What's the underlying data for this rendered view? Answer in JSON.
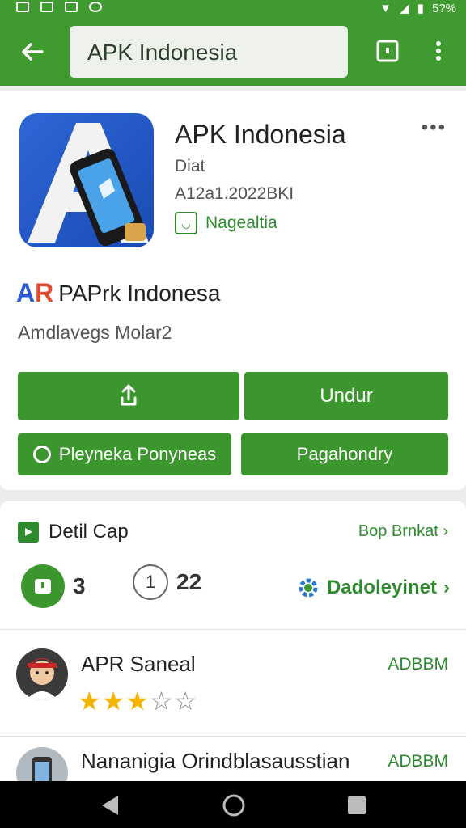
{
  "status_bar": {
    "battery": "5?%"
  },
  "top_bar": {
    "search_text": "APK Indonesia"
  },
  "app_header": {
    "title": "APK Indonesia",
    "subtitle": "Diat",
    "meta": "A12a1.2022BKI",
    "badge_label": "Nagealtia"
  },
  "brand": {
    "logo_a": "A",
    "logo_r": "R",
    "title": "PAPrk Indonesa",
    "subtitle": "Amdlavegs Molar2"
  },
  "buttons": {
    "share_icon": "⇧",
    "unduh": "Undur",
    "preview": "Pleyneka Ponyneas",
    "page": "Pagahondry"
  },
  "details": {
    "section_title": "Detil Cap",
    "see_more": "Bop Brnkat",
    "stat1_value": "3",
    "stat2_circle": "1",
    "stat2_value": "22",
    "developer_link": "Dadoleyinet"
  },
  "reviews": [
    {
      "name": "APR Saneal",
      "tag": "ADBBM",
      "rating": 3,
      "max": 5
    },
    {
      "name": "Nananigia Orindblasausstian",
      "tag": "ADBBM"
    }
  ],
  "colors": {
    "primary": "#3f9a2f",
    "button": "#3c962e",
    "star": "#f4b400"
  },
  "icons": [
    "back-arrow-icon",
    "bookmark-icon",
    "more-vert-icon",
    "share-icon",
    "play-icon",
    "gear-icon",
    "chevron-right-icon"
  ]
}
